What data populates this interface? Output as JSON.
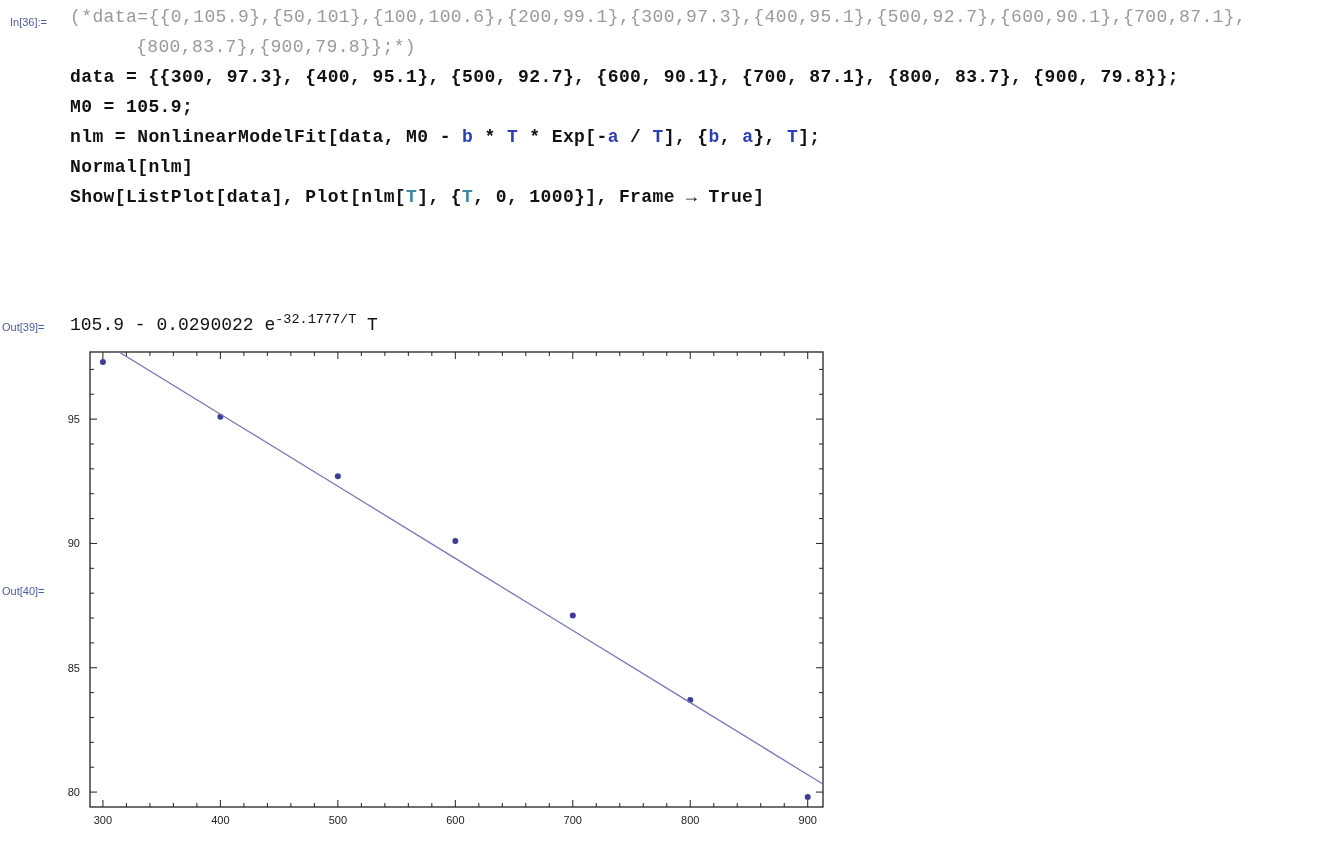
{
  "cells": [
    {
      "kind": "input",
      "label": "In[36]:=",
      "lines": [
        {
          "wrapped": false,
          "segments": [
            {
              "kind": "comment",
              "text": "(*data={{0,105.9},{50,101},{100,100.6},{200,99.1},{300,97.3},{400,95.1},{500,92.7},{600,90.1},{700,87.1},"
            }
          ]
        },
        {
          "wrapped": true,
          "segments": [
            {
              "kind": "comment",
              "text": "{800,83.7},{900,79.8}};*)"
            }
          ]
        },
        {
          "wrapped": false,
          "segments": [
            {
              "kind": "code",
              "text": "data = {{300, 97.3}, {400, 95.1}, {500, 92.7}, {600, 90.1}, {700, 87.1}, {800, 83.7}, {900, 79.8}};"
            }
          ]
        },
        {
          "wrapped": false,
          "segments": [
            {
              "kind": "code",
              "text": "M0 = 105.9;"
            }
          ]
        },
        {
          "wrapped": false,
          "segments": [
            {
              "kind": "code",
              "text": "nlm = NonlinearModelFit[data, M0 - "
            },
            {
              "kind": "variable",
              "text": "b"
            },
            {
              "kind": "code",
              "text": " * "
            },
            {
              "kind": "variable",
              "text": "T"
            },
            {
              "kind": "code",
              "text": " * Exp[-"
            },
            {
              "kind": "variable",
              "text": "a"
            },
            {
              "kind": "code",
              "text": " / "
            },
            {
              "kind": "variable",
              "text": "T"
            },
            {
              "kind": "code",
              "text": "], {"
            },
            {
              "kind": "variable",
              "text": "b"
            },
            {
              "kind": "code",
              "text": ", "
            },
            {
              "kind": "variable",
              "text": "a"
            },
            {
              "kind": "code",
              "text": "}, "
            },
            {
              "kind": "variable",
              "text": "T"
            },
            {
              "kind": "code",
              "text": "];"
            }
          ]
        },
        {
          "wrapped": false,
          "segments": [
            {
              "kind": "code",
              "text": "Normal[nlm]"
            }
          ]
        },
        {
          "wrapped": false,
          "segments": [
            {
              "kind": "code",
              "text": "Show[ListPlot[data], Plot[nlm["
            },
            {
              "kind": "local",
              "text": "T"
            },
            {
              "kind": "code",
              "text": "], {"
            },
            {
              "kind": "local",
              "text": "T"
            },
            {
              "kind": "code",
              "text": ", 0, 1000}], Frame → True]"
            }
          ]
        }
      ]
    },
    {
      "kind": "output",
      "label": "Out[39]=",
      "expression": "105.9 - 0.0290022 e$^{-32.1777/T}$ T"
    },
    {
      "kind": "plot",
      "label": "Out[40]=",
      "chart_data": {
        "type": "scatter",
        "x": [
          300,
          400,
          500,
          600,
          700,
          800,
          900
        ],
        "series": [
          {
            "type": "scatter",
            "color": "#3d3d99",
            "values": [
              97.3,
              95.1,
              92.7,
              90.1,
              87.1,
              83.7,
              79.8
            ]
          },
          {
            "type": "line",
            "color": "#7777bb",
            "values": [
              null,
              95.2,
              92.3,
              89.4,
              86.5,
              83.6,
              80.7
            ]
          }
        ],
        "xlim": [
          289,
          913
        ],
        "ylim": [
          79.4,
          97.7
        ],
        "xticks": [
          300,
          400,
          500,
          600,
          700,
          800,
          900
        ],
        "yticks": [
          80,
          85,
          90,
          95
        ]
      }
    }
  ]
}
